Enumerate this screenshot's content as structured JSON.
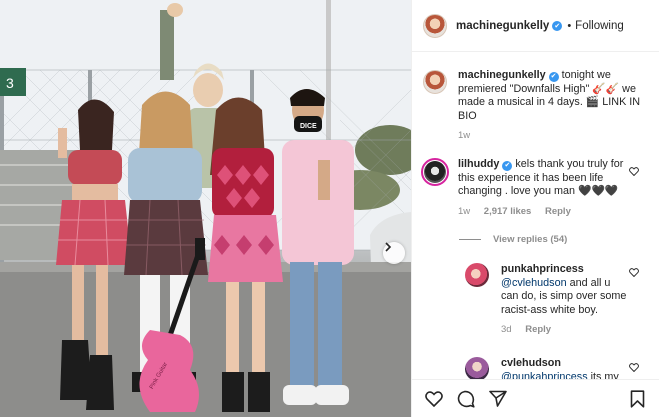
{
  "post": {
    "header": {
      "username": "machinegunkelly",
      "verified_mark": "✔",
      "separator": "•",
      "follow_status": "Following"
    },
    "caption": {
      "username": "machinegunkelly",
      "verified_mark": "✔",
      "text": " tonight we premiered \"Downfalls High\" 🎸🎸 we made a musical in 4 days. 🎬 LINK IN BIO",
      "age": "1w"
    },
    "comments": [
      {
        "username": "lilhuddy",
        "verified_mark": "✔",
        "text": " kels thank you truly for this experience it has been life changing . love you man 🖤🖤🖤",
        "age": "1w",
        "likes": "2,917 likes",
        "reply_label": "Reply",
        "view_replies": "View replies (54)"
      },
      {
        "username": "punkahprincess",
        "mention": "@cvlehudson",
        "text": " and all u can do, is simp over some racist-ass white boy.",
        "age": "3d",
        "reply_label": "Reply"
      },
      {
        "username": "cvlehudson",
        "mention": "@punkahprincess",
        "text": " its my",
        "age": "",
        "reply_label": ""
      }
    ],
    "photo": {
      "scoreboard_number": "3",
      "mask_text": "DICE",
      "guitar_text": "Pink Guitar"
    }
  },
  "icons": {
    "like": "heart-icon",
    "comment": "comment-icon",
    "share": "paper-plane-icon",
    "save": "bookmark-icon",
    "next": "chevron-right-icon"
  },
  "colors": {
    "verified": "#3897f0",
    "mention": "#00376b",
    "muted": "#8e8e8e",
    "story_ring": "#d6249f"
  }
}
